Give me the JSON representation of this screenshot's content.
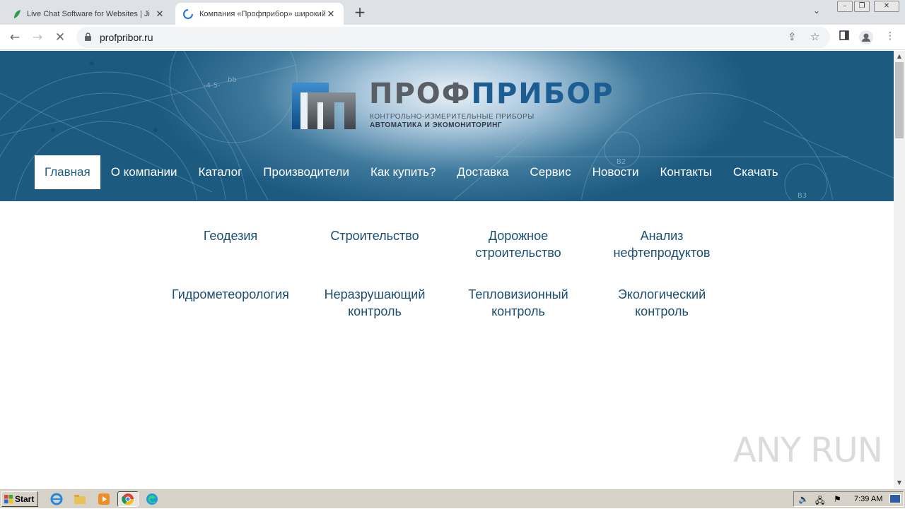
{
  "browser": {
    "tabs": [
      {
        "title": "Live Chat Software for Websites | Ji",
        "active": false,
        "icon": "leaf-favicon"
      },
      {
        "title": "Компания «Профприбор» широкий",
        "active": true,
        "icon": "loading-spinner"
      }
    ],
    "new_tab_label": "+",
    "url": "profpribor.ru"
  },
  "site": {
    "logo": {
      "name_part1": "ПРОФ",
      "name_part2": "ПРИБОР",
      "subtitle1": "КОНТРОЛЬНО-ИЗМЕРИТЕЛЬНЫЕ ПРИБОРЫ",
      "subtitle2": "АВТОМАТИКА И ЭКОМОНИТОРИНГ"
    },
    "menu": [
      {
        "label": "Главная",
        "active": true
      },
      {
        "label": "О компании"
      },
      {
        "label": "Каталог"
      },
      {
        "label": "Производители"
      },
      {
        "label": "Как купить?"
      },
      {
        "label": "Доставка"
      },
      {
        "label": "Сервис"
      },
      {
        "label": "Новости"
      },
      {
        "label": "Контакты"
      },
      {
        "label": "Скачать"
      }
    ],
    "categories": [
      [
        "Геодезия"
      ],
      [
        "Строительство"
      ],
      [
        "Дорожное",
        "строительство"
      ],
      [
        "Анализ",
        "нефтепродуктов"
      ],
      [
        "Гидрометеорология"
      ],
      [
        "Неразрушающий",
        "контроль"
      ],
      [
        "Тепловизионный",
        "контроль"
      ],
      [
        "Экологический",
        "контроль"
      ]
    ],
    "colors": {
      "banner": "#1c5a80",
      "link": "#1b4e72",
      "logo_blue": "#1c5d92",
      "logo_gray": "#5a5f66"
    }
  },
  "watermark": "ANY RUN",
  "taskbar": {
    "start_label": "Start",
    "clock": "7:39 AM",
    "icons": [
      "ie-icon",
      "explorer-icon",
      "media-player-icon",
      "chrome-icon",
      "edge-icon"
    ]
  }
}
